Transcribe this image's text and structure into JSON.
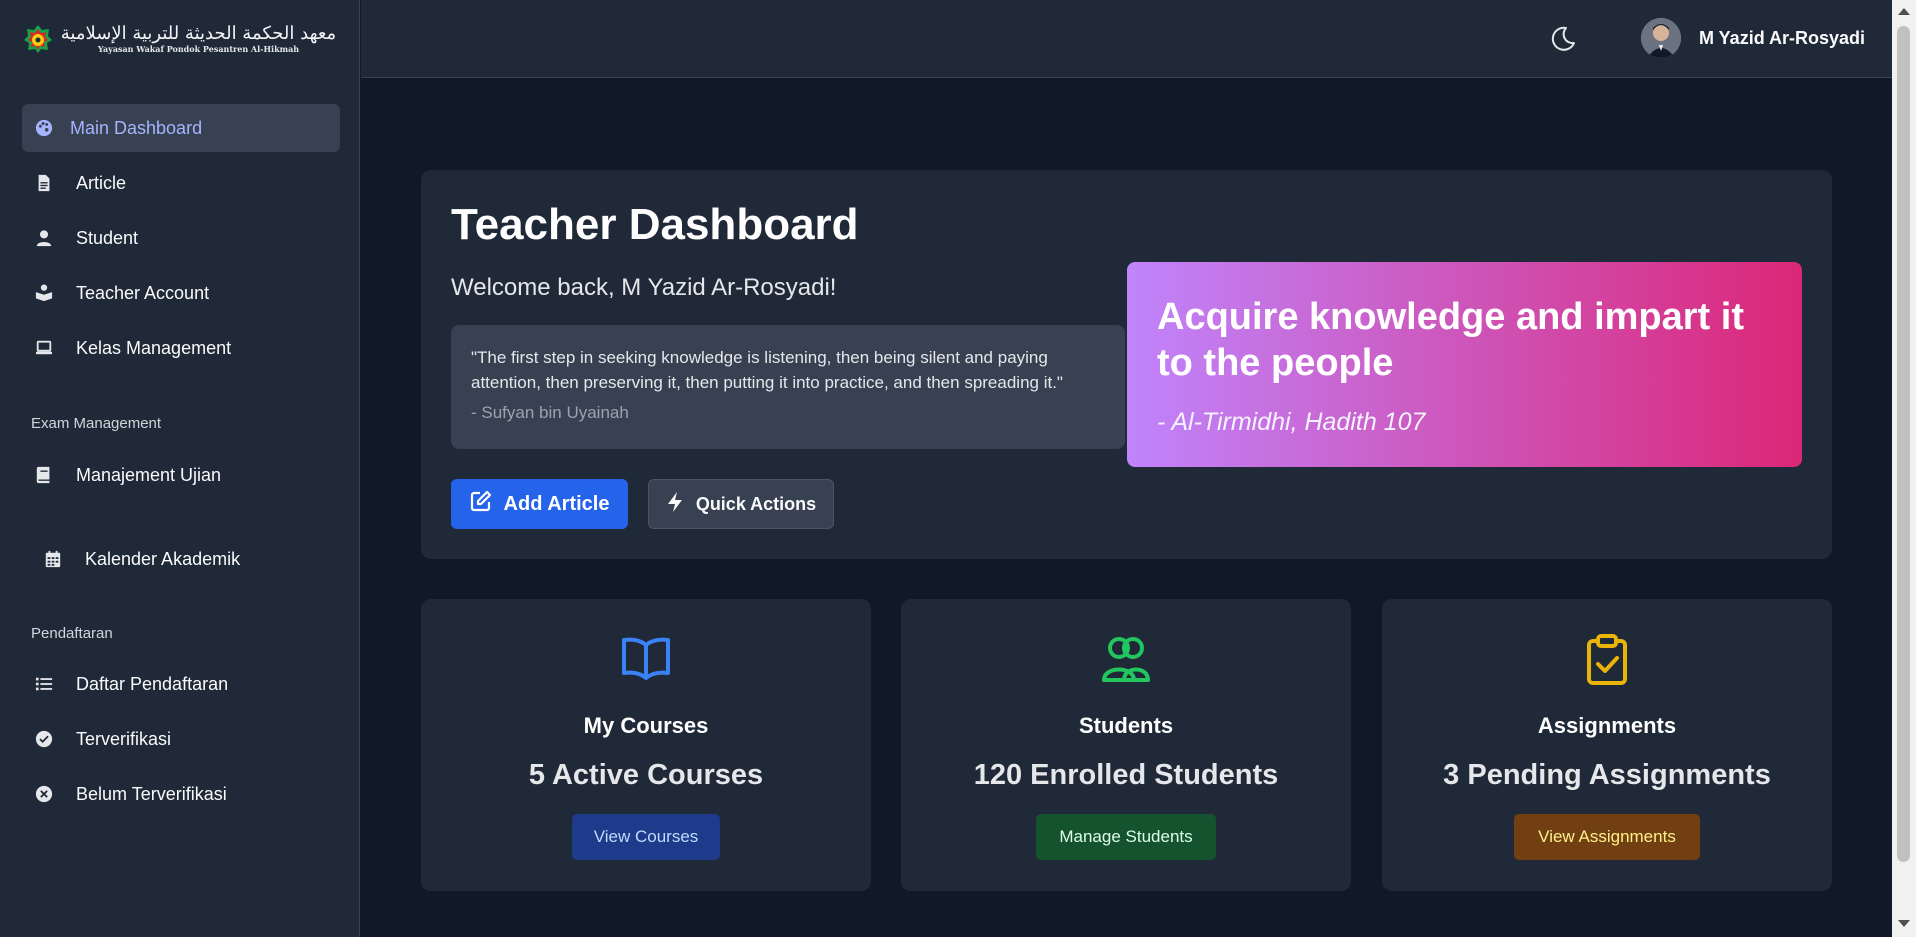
{
  "brand": {
    "arabic": "معهد الحكمة الحديثة للتربية الإسلامية",
    "subtitle": "Yayasan Wakaf Pondok Pesantren Al-Hikmah"
  },
  "sidebar": {
    "items": [
      {
        "label": "Main Dashboard",
        "icon": "palette-icon",
        "active": true
      },
      {
        "label": "Article",
        "icon": "file-icon"
      },
      {
        "label": "Student",
        "icon": "user-icon"
      },
      {
        "label": "Teacher Account",
        "icon": "reader-icon"
      },
      {
        "label": "Kelas Management",
        "icon": "laptop-icon"
      }
    ],
    "exam_section": {
      "label": "Exam Management",
      "items": [
        {
          "label": "Manajement Ujian",
          "icon": "book-icon"
        },
        {
          "label": "Kalender Akademik",
          "icon": "calendar-icon"
        }
      ]
    },
    "registration_section": {
      "label": "Pendaftaran",
      "items": [
        {
          "label": "Daftar Pendaftaran",
          "icon": "list-icon"
        },
        {
          "label": "Terverifikasi",
          "icon": "check-circle-icon"
        },
        {
          "label": "Belum Terverifikasi",
          "icon": "x-circle-icon"
        }
      ]
    }
  },
  "header": {
    "theme_icon": "moon-icon",
    "user_name": "M Yazid Ar-Rosyadi"
  },
  "hero": {
    "title": "Teacher Dashboard",
    "welcome": "Welcome back, M Yazid Ar-Rosyadi!",
    "quote": "\"The first step in seeking knowledge is listening, then being silent and paying attention, then preserving it, then putting it into practice, and then spreading it.\"",
    "quote_author": "- Sufyan bin Uyainah",
    "add_article_label": "Add Article",
    "quick_actions_label": "Quick Actions",
    "banner_title": "Acquire knowledge and impart it to the people",
    "banner_source": "- Al-Tirmidhi, Hadith 107"
  },
  "stats": [
    {
      "title": "My Courses",
      "value": "5 Active Courses",
      "button": "View Courses",
      "icon": "book-open-icon",
      "color": "#3b82f6",
      "btn_bg": "#1e3a8a",
      "btn_fg": "#bfdbfe"
    },
    {
      "title": "Students",
      "value": "120 Enrolled Students",
      "button": "Manage Students",
      "icon": "users-icon",
      "color": "#22c55e",
      "btn_bg": "#14532d",
      "btn_fg": "#dcfce7"
    },
    {
      "title": "Assignments",
      "value": "3 Pending Assignments",
      "button": "View Assignments",
      "icon": "clipboard-check-icon",
      "color": "#eab308",
      "btn_bg": "#713f12",
      "btn_fg": "#fef08a"
    }
  ]
}
